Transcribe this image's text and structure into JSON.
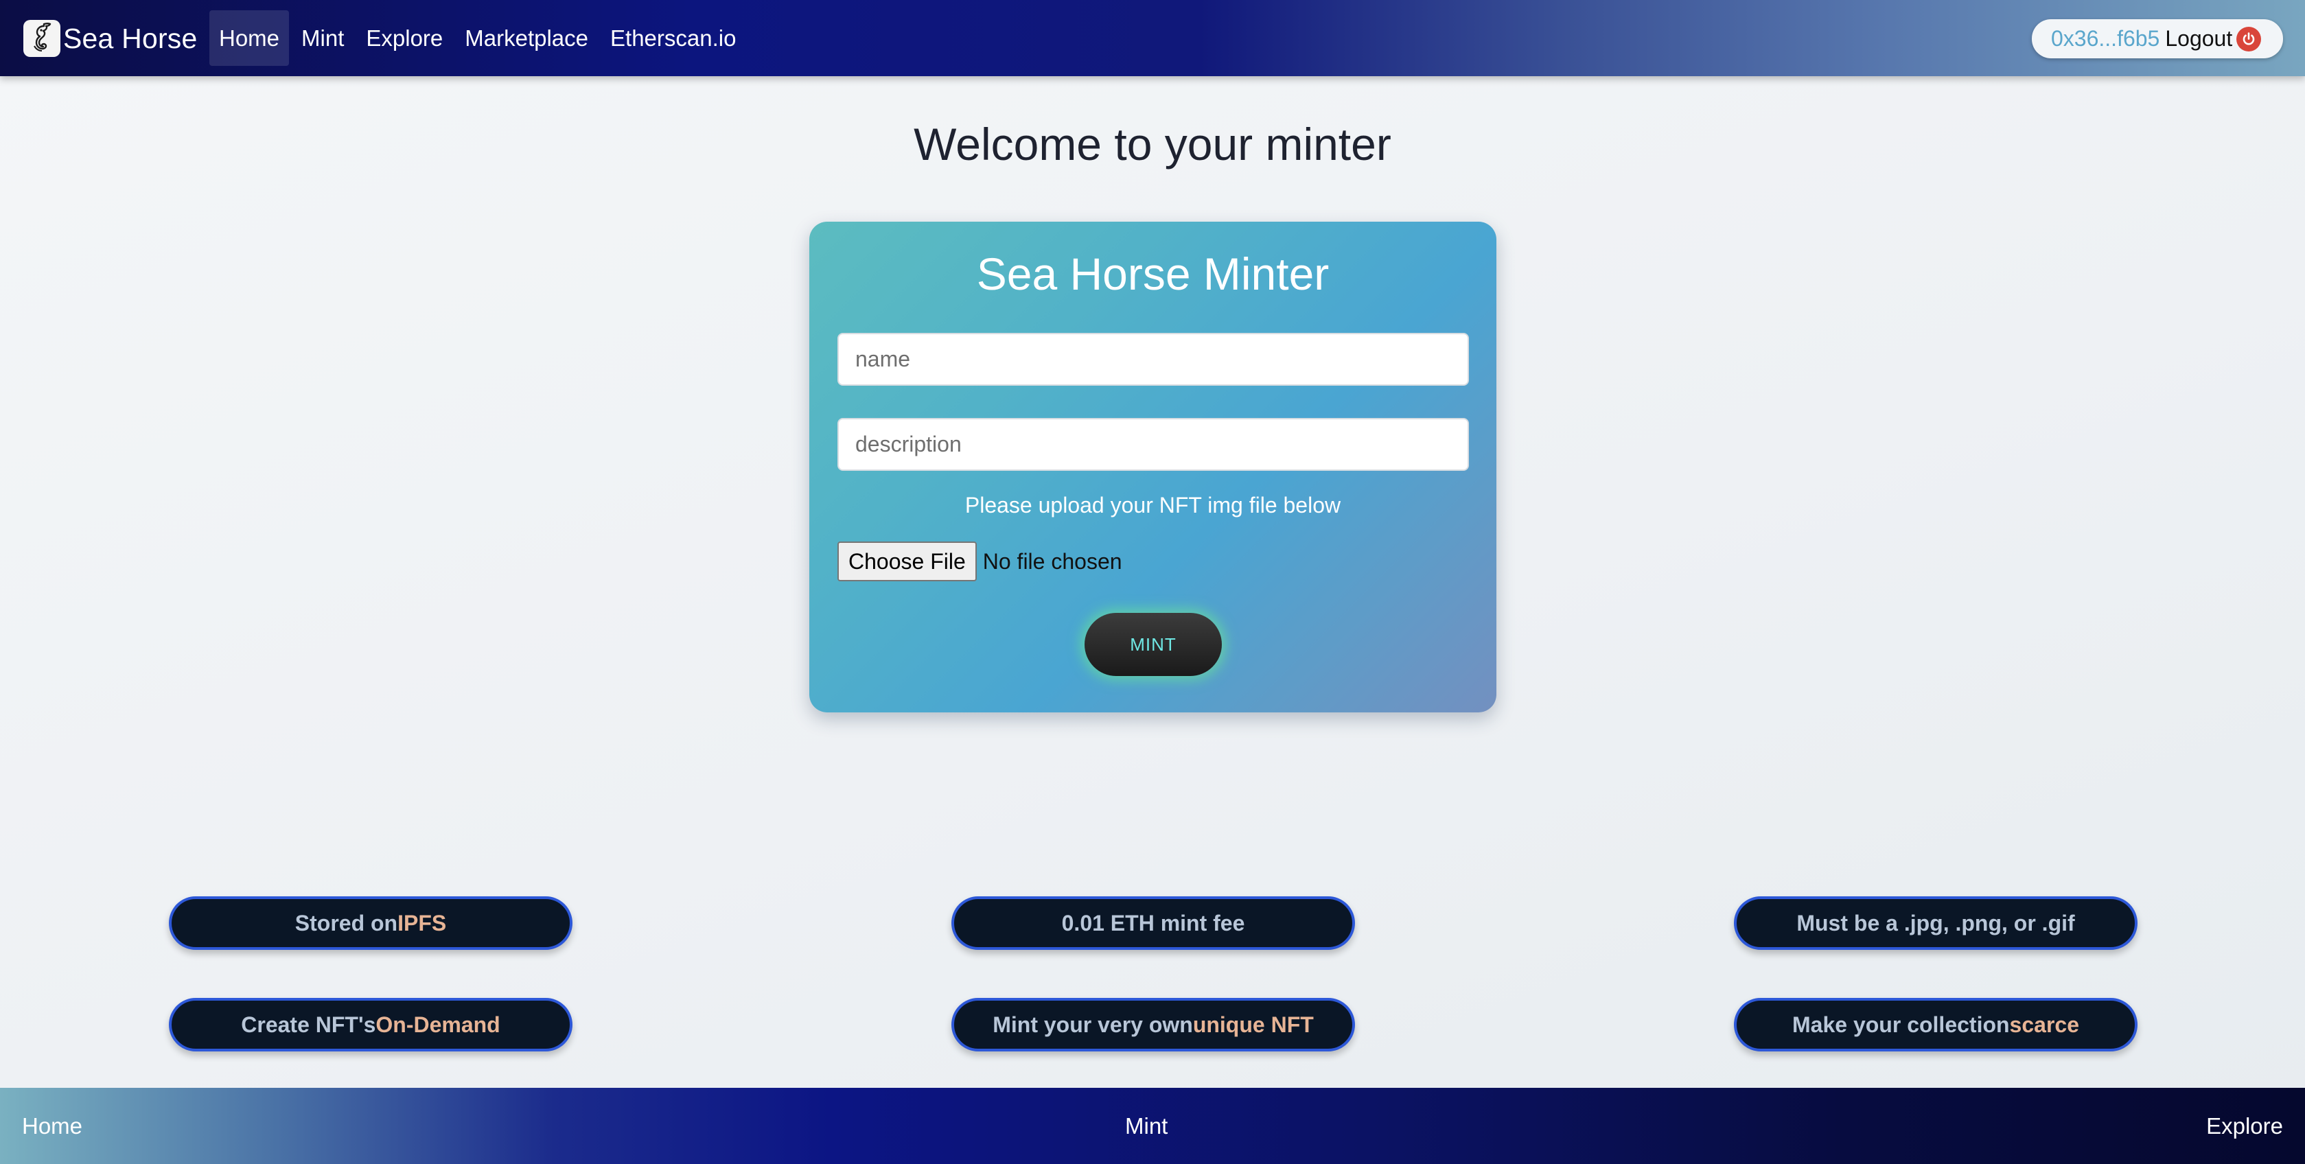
{
  "brand": {
    "name": "Sea Horse",
    "logo_icon": "seahorse-icon"
  },
  "nav": {
    "items": [
      {
        "label": "Home",
        "active": true
      },
      {
        "label": "Mint",
        "active": false
      },
      {
        "label": "Explore",
        "active": false
      },
      {
        "label": "Marketplace",
        "active": false
      },
      {
        "label": "Etherscan.io",
        "active": false
      }
    ]
  },
  "account": {
    "address": "0x36...f6b5",
    "logout_label": "Logout",
    "logout_icon": "power-icon"
  },
  "main": {
    "title": "Welcome to your minter"
  },
  "minter": {
    "title": "Sea Horse Minter",
    "name_placeholder": "name",
    "name_value": "",
    "description_placeholder": "description",
    "description_value": "",
    "upload_hint": "Please upload your NFT img file below",
    "choose_file_label": "Choose File",
    "file_status": "No file chosen",
    "mint_label": "MINT"
  },
  "features": [
    {
      "prefix": "Stored on ",
      "highlight": "IPFS"
    },
    {
      "prefix": "0.01 ETH mint fee",
      "highlight": ""
    },
    {
      "prefix": "Must be a .jpg, .png, or .gif",
      "highlight": ""
    },
    {
      "prefix": "Create NFT's ",
      "highlight": "On-Demand"
    },
    {
      "prefix": "Mint your very own ",
      "highlight": "unique NFT"
    },
    {
      "prefix": "Make your collection ",
      "highlight": "scarce"
    }
  ],
  "footer": {
    "links": [
      {
        "label": "Home"
      },
      {
        "label": "Mint"
      },
      {
        "label": "Explore"
      }
    ]
  },
  "colors": {
    "navbar_start": "#0b0d45",
    "navbar_end": "#79a6c0",
    "card_gradient_start": "#5cbcc0",
    "card_gradient_end": "#7390c0",
    "pill_border": "#2d58d8",
    "pill_bg": "#0a1626",
    "highlight_text": "#e7b495",
    "mint_glow": "#6ef08c",
    "address_text": "#5aa6cc",
    "logout_icon_bg": "#d9453a"
  }
}
